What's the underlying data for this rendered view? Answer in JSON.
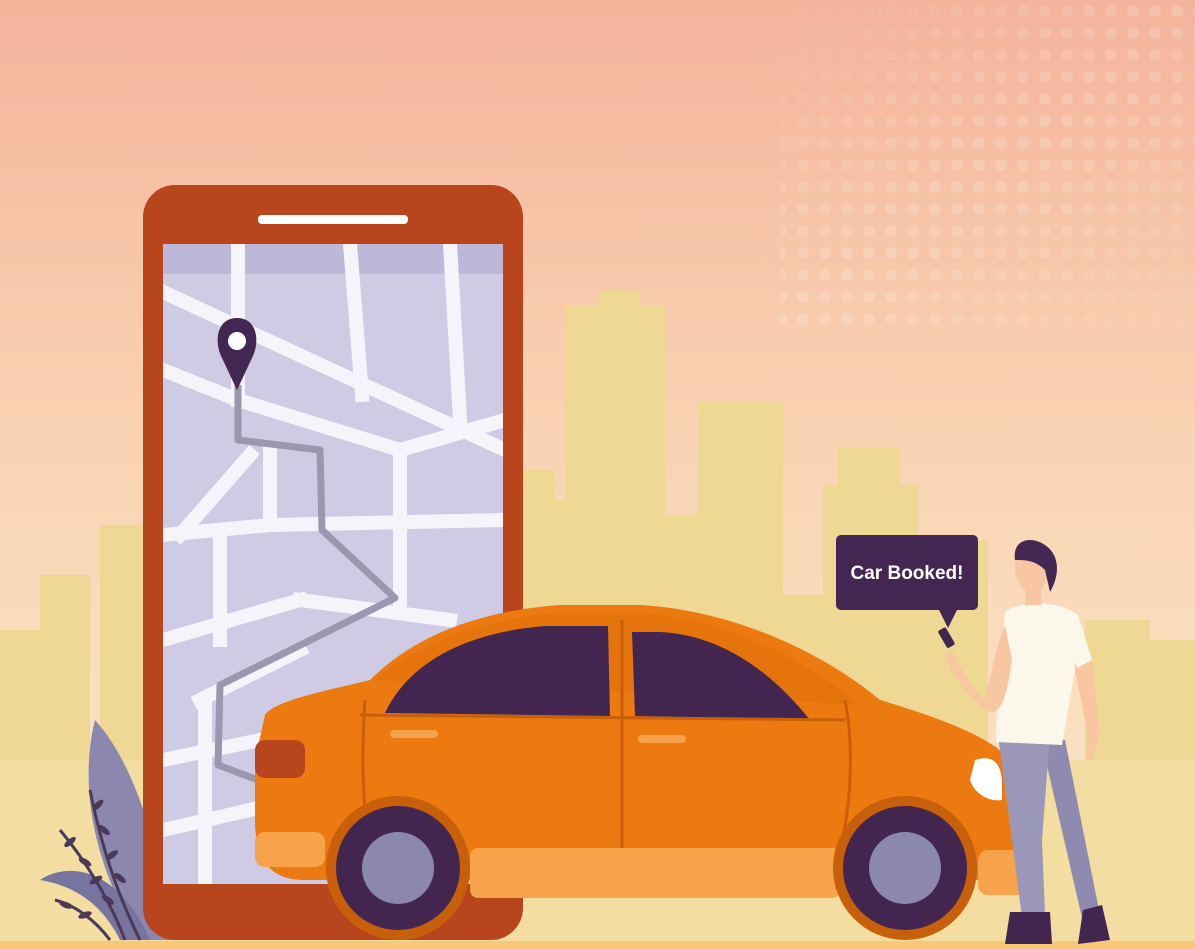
{
  "speech_bubble": {
    "text": "Car Booked!"
  },
  "colors": {
    "sky_top": "#f4b39c",
    "sky_bottom": "#fbe7c7",
    "ground": "#f3dda1",
    "buildings": "#efd794",
    "phone_frame": "#b8451b",
    "map_bg": "#cfcbe4",
    "map_roads": "#f6f4fb",
    "route": "#9a97ae",
    "pin": "#432651",
    "car_body": "#ec7a10",
    "car_windows": "#43264f",
    "bubble": "#432651",
    "shirt": "#fbf7ea",
    "pants": "#9b97b8"
  },
  "icons": [
    "map-pin-icon",
    "smartphone-icon"
  ]
}
